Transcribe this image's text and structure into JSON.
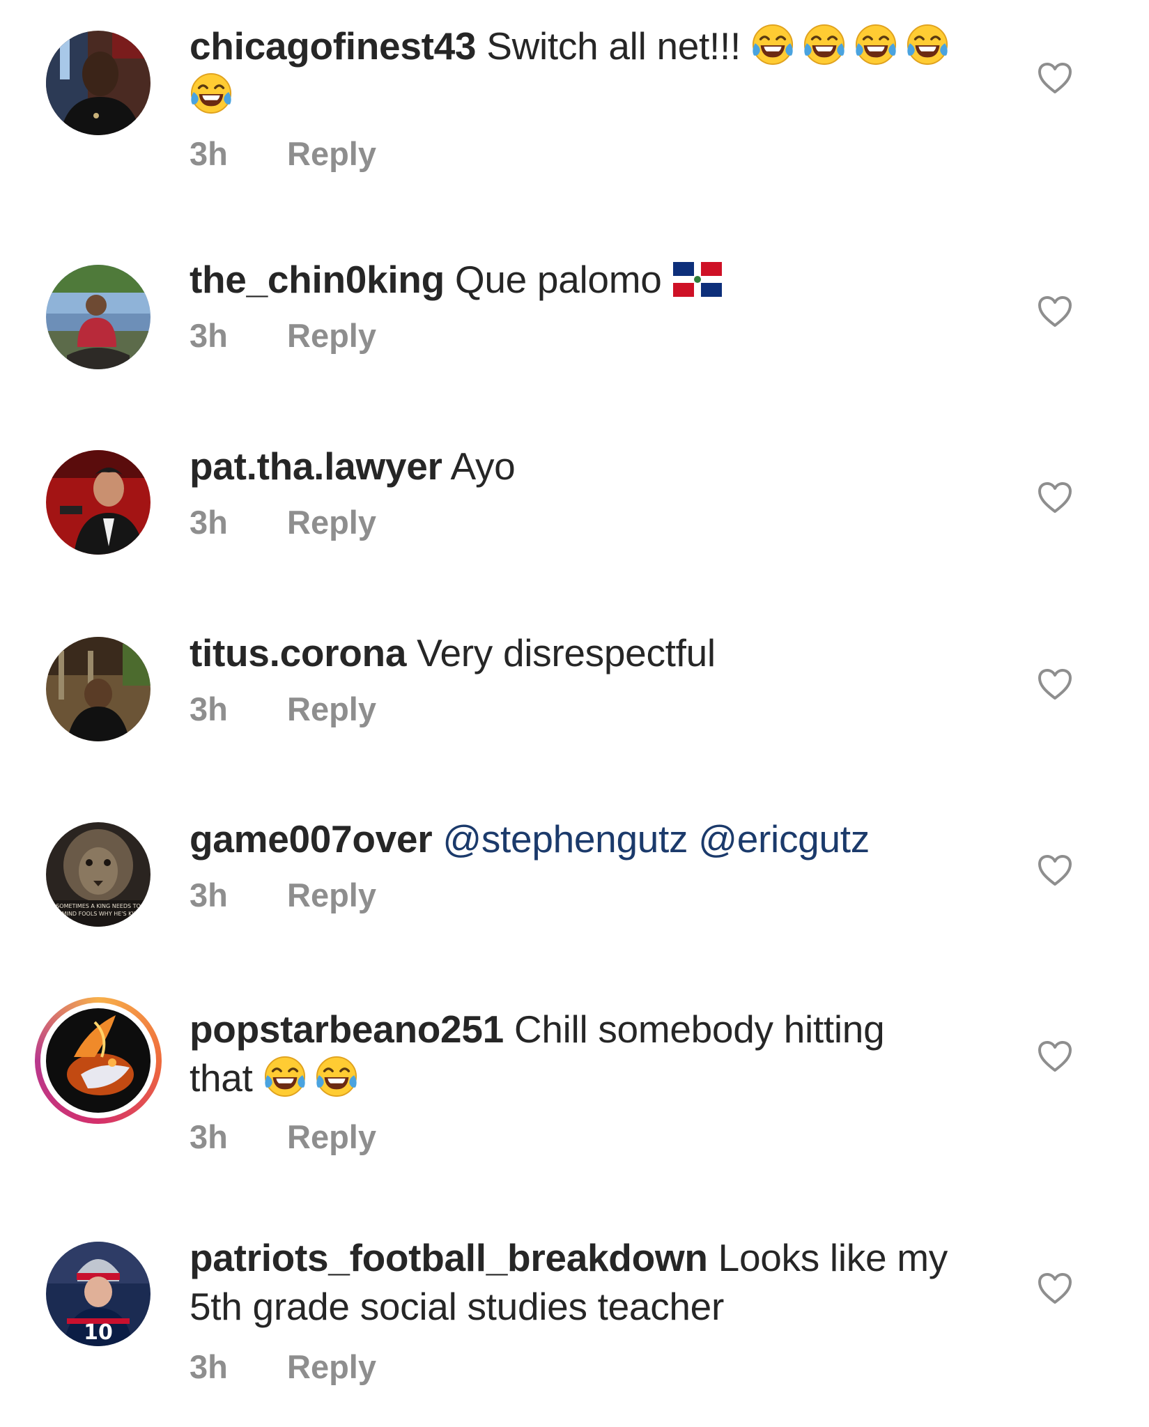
{
  "comments": [
    {
      "username": "chicagofinest43",
      "text_line1": "Switch all net!!!",
      "emoji_count_line1": 4,
      "emoji_count_line2": 1,
      "emoji": "face-with-tears-of-joy",
      "time": "3h",
      "reply_label": "Reply"
    },
    {
      "username": "the_chin0king",
      "text": "Que palomo",
      "emoji": "flag-dominican-republic",
      "time": "3h",
      "reply_label": "Reply"
    },
    {
      "username": "pat.tha.lawyer",
      "text": "Ayo",
      "time": "3h",
      "reply_label": "Reply"
    },
    {
      "username": "titus.corona",
      "text": "Very disrespectful",
      "time": "3h",
      "reply_label": "Reply"
    },
    {
      "username": "game007over",
      "mention1": "@stephengutz",
      "mention2": "@ericgutz",
      "avatar_caption_line1": "SOMETIMES A KING NEEDS TO",
      "avatar_caption_line2": "REMIND FOOLS WHY HE'S KING",
      "time": "3h",
      "reply_label": "Reply"
    },
    {
      "username": "popstarbeano251",
      "text_line1": "Chill somebody hitting",
      "text_line2": "that",
      "emoji_count_line2": 2,
      "emoji": "face-with-tears-of-joy",
      "has_story_ring": true,
      "time": "3h",
      "reply_label": "Reply"
    },
    {
      "username": "patriots_football_breakdown",
      "text_line1": "Looks like my",
      "text_line2": "5th grade social studies teacher",
      "avatar_jersey_number": "10",
      "time": "3h",
      "reply_label": "Reply"
    }
  ],
  "icons": {
    "like": "heart-outline-icon",
    "emoji_laugh": "face-with-tears-of-joy",
    "flag": "flag-dominican-republic"
  },
  "colors": {
    "text": "#262626",
    "meta": "#8e8e8e",
    "mention": "#1b3a6b",
    "heart": "#8e8e8e",
    "background": "#ffffff"
  }
}
